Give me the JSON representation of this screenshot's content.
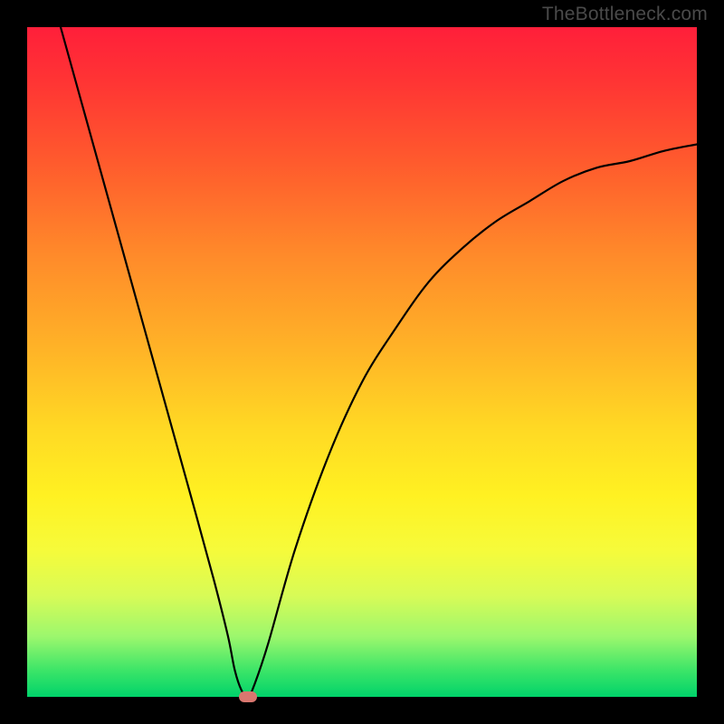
{
  "watermark": "TheBottleneck.com",
  "colors": {
    "frame": "#000000",
    "curve": "#000000",
    "marker": "#d9776f",
    "gradient_top": "#ff1f3a",
    "gradient_bottom": "#00d36a"
  },
  "chart_data": {
    "type": "line",
    "title": "",
    "xlabel": "",
    "ylabel": "",
    "xlim": [
      0,
      100
    ],
    "ylim": [
      0,
      100
    ],
    "series": [
      {
        "name": "bottleneck-curve",
        "x": [
          5,
          10,
          15,
          20,
          25,
          28,
          30,
          31,
          32,
          33,
          34,
          36,
          40,
          45,
          50,
          55,
          60,
          65,
          70,
          75,
          80,
          85,
          90,
          95,
          100
        ],
        "y": [
          100,
          82,
          64,
          46,
          28,
          17,
          9,
          4,
          1,
          0,
          2,
          8,
          22,
          36,
          47,
          55,
          62,
          67,
          71,
          74,
          77,
          79,
          80,
          81.5,
          82.5
        ]
      }
    ],
    "annotations": [
      {
        "name": "min-marker",
        "x": 33,
        "y": 0
      }
    ],
    "grid": false,
    "legend": false
  }
}
